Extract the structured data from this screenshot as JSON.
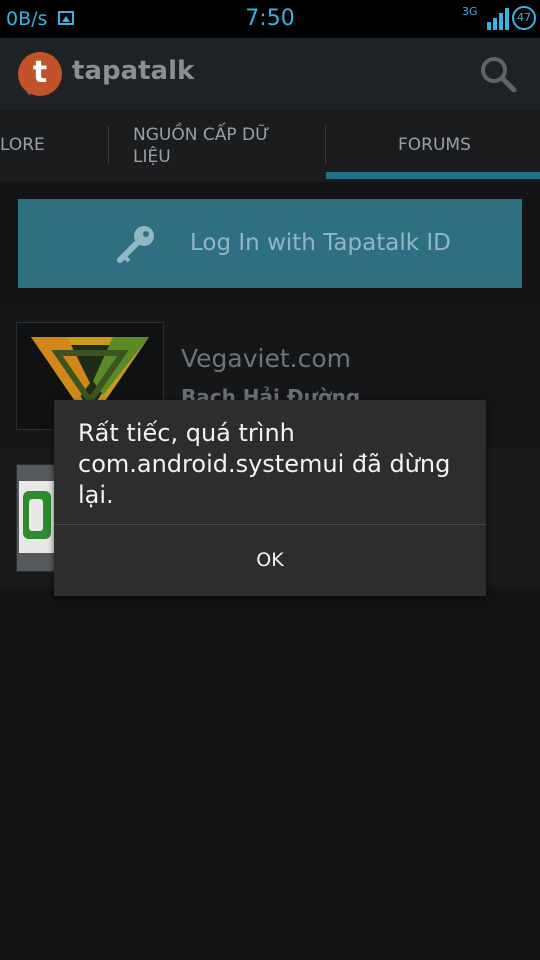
{
  "status_bar": {
    "net_speed": "0B/s",
    "time": "7:50",
    "network_type": "3G",
    "battery": "47",
    "color": "#33b5e5"
  },
  "app_bar": {
    "logo_letter": "t",
    "app_name": "tapatalk",
    "search_icon": "search-icon"
  },
  "tabs": [
    {
      "label": "LORE"
    },
    {
      "label": "NGUỒN CẤP DỮ LIỆU"
    },
    {
      "label": "FORUMS",
      "selected": true
    }
  ],
  "login_button": {
    "label": "Log In with Tapatalk ID",
    "icon": "key-icon"
  },
  "forums": [
    {
      "title": "Vegaviet.com",
      "subtitle": "Bạch Hải Đường"
    },
    {
      "title": "",
      "subtitle": ""
    }
  ],
  "dialog": {
    "message": "Rất tiếc, quá trình com.android.systemui đã dừng lại.",
    "ok_label": "OK"
  },
  "accent_color": "#33b5e5"
}
